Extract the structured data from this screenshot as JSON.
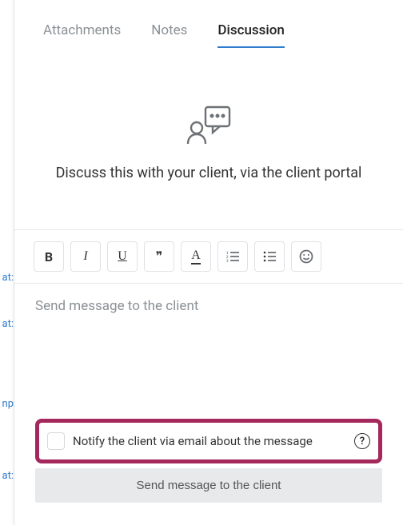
{
  "tabs": {
    "attachments": "Attachments",
    "notes": "Notes",
    "discussion": "Discussion"
  },
  "empty": {
    "text": "Discuss this with your client, via the client portal"
  },
  "toolbar": {
    "bold": "B",
    "italic": "I",
    "underline": "U",
    "quote": "❞",
    "color": "A",
    "olist": "≡",
    "ulist": "≡",
    "emoji": "☺"
  },
  "editor": {
    "placeholder": "Send message to the client"
  },
  "footer": {
    "notify_label": "Notify the client via email about the message",
    "help": "?",
    "send_label": "Send message to the client"
  },
  "side_texts": {
    "a1": "at:",
    "a2": "at:",
    "a3": "np",
    "a4": "at:"
  }
}
